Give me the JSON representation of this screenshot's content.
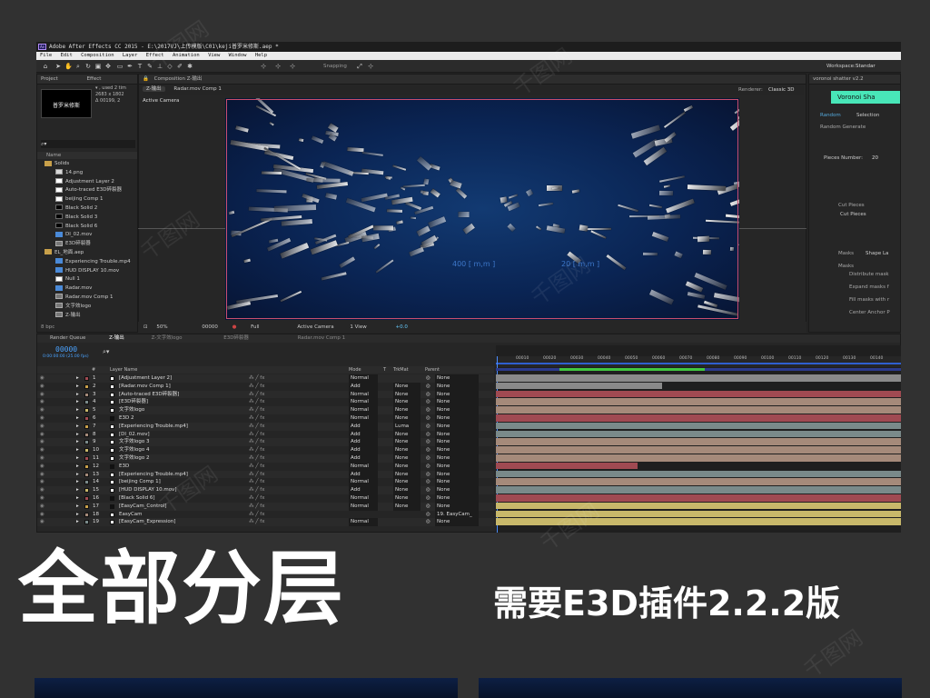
{
  "window": {
    "title": "Adobe After Effects CC 2015 - E:\\2017VJ\\上传模版\\C01\\keji普罗米修斯.aep *",
    "app_badge": "Ae"
  },
  "menu": [
    "File",
    "Edit",
    "Composition",
    "Layer",
    "Effect",
    "Animation",
    "View",
    "Window",
    "Help"
  ],
  "toolbar": {
    "snapping": "Snapping",
    "workspace_label": "Workspace:",
    "workspace_value": "Standar"
  },
  "project": {
    "tab": "Project",
    "tab2": "Effect",
    "thumb_caption": "普罗米修斯",
    "info": [
      "▾ , used 2 tim",
      "2683 x 1802",
      "Δ 00199, 2"
    ],
    "column_name": "Name",
    "items": [
      {
        "label": "Solids",
        "indent": 0,
        "type": "folder"
      },
      {
        "label": "14.png",
        "indent": 1,
        "type": "image"
      },
      {
        "label": "Adjustment Layer 2",
        "indent": 1,
        "type": "solid-white"
      },
      {
        "label": "Auto-traced E3D碎裂器",
        "indent": 1,
        "type": "solid-white"
      },
      {
        "label": "beijing Comp 1",
        "indent": 1,
        "type": "solid-white"
      },
      {
        "label": "Black Solid 2",
        "indent": 1,
        "type": "solid-black"
      },
      {
        "label": "Black Solid 3",
        "indent": 1,
        "type": "solid-black"
      },
      {
        "label": "Black Solid 6",
        "indent": 1,
        "type": "solid-black"
      },
      {
        "label": "DI_02.mov",
        "indent": 1,
        "type": "footage"
      },
      {
        "label": "E3D碎裂器",
        "indent": 1,
        "type": "comp"
      },
      {
        "label": "EL_地面.aep",
        "indent": 0,
        "type": "folder"
      },
      {
        "label": "Experiencing Trouble.mp4",
        "indent": 1,
        "type": "footage"
      },
      {
        "label": "HUD DISPLAY 10.mov",
        "indent": 1,
        "type": "footage"
      },
      {
        "label": "Null 1",
        "indent": 1,
        "type": "solid-white"
      },
      {
        "label": "Radar.mov",
        "indent": 1,
        "type": "footage"
      },
      {
        "label": "Radar.mov Comp 1",
        "indent": 1,
        "type": "comp"
      },
      {
        "label": "文字效logo",
        "indent": 1,
        "type": "comp"
      },
      {
        "label": "Z-输出",
        "indent": 1,
        "type": "comp"
      }
    ],
    "bpc": "8 bpc"
  },
  "composition": {
    "tab": "Composition Z-输出",
    "subtab1": "Z-输出",
    "subtab2": "Radar.mov Comp 1",
    "renderer_label": "Renderer:",
    "renderer_value": "Classic 3D",
    "camera_label": "Active Camera",
    "hud_text": "400 [ m,m ]",
    "hud_text2": "20 [ m,m ]",
    "zoom": "50%",
    "timecode": "00000",
    "resolution": "Full",
    "view_camera": "Active Camera",
    "views": "1 View",
    "exposure": "+0.0"
  },
  "effect_panel": {
    "title": "voronoi shatter v2.2",
    "button": "Voronoi Sha",
    "tabs": [
      "Random",
      "Selection"
    ],
    "section": "Random Generate",
    "pieces_label": "Pieces Number:",
    "pieces_value": "20",
    "cut_section": "Cut Pieces",
    "cut_label": "Cut Pieces",
    "tabs2": [
      "Masks",
      "Shape La"
    ],
    "masks_section": "Masks",
    "options": [
      "Distribute mask",
      "Expand masks f",
      "Fill masks with r",
      "Center Anchor P"
    ]
  },
  "timeline": {
    "tabs": [
      "Render Queue",
      "Z-输出",
      "Z-文字效logo",
      "E3D碎裂器",
      "Radar.mov Comp 1"
    ],
    "timecode": "00000",
    "timecode_sub": "0:00:00:00 (25.00 fps)",
    "columns": {
      "num": "#",
      "name": "Layer Name",
      "mode": "Mode",
      "t": "T",
      "trkmat": "TrkMat",
      "parent": "Parent"
    },
    "ruler": [
      "00010",
      "00020",
      "00030",
      "00040",
      "00050",
      "00060",
      "00070",
      "00080",
      "00090",
      "00100",
      "00110",
      "00120",
      "00130",
      "00140"
    ],
    "layers": [
      {
        "num": "1",
        "name": "[Adjustment Layer 2]",
        "color": "#ffffff",
        "mode": "Normal",
        "trkmat": "",
        "parent": "None",
        "bar": "#8a8a8a",
        "bar_end": 1.0
      },
      {
        "num": "2",
        "name": "[Radar.mov Comp 1]",
        "color": "#ffffff",
        "mode": "Add",
        "trkmat": "None",
        "parent": "None",
        "bar": "#8a8a8a",
        "bar_end": 0.41
      },
      {
        "num": "3",
        "name": "[Auto-traced E3D碎裂器]",
        "color": "#ffffff",
        "mode": "Normal",
        "trkmat": "None",
        "parent": "None",
        "bar": "#a04a52",
        "bar_end": 1.0
      },
      {
        "num": "4",
        "name": "[E3D碎裂器]",
        "color": "#ffffff",
        "mode": "Normal",
        "trkmat": "None",
        "parent": "None",
        "bar": "#a58a7a",
        "bar_end": 1.0
      },
      {
        "num": "5",
        "name": "文字效logo",
        "color": "#ffffff",
        "mode": "Normal",
        "trkmat": "None",
        "parent": "None",
        "bar": "#a58a7a",
        "bar_end": 1.0
      },
      {
        "num": "6",
        "name": "E3D 2",
        "color": "#111111",
        "mode": "Normal",
        "trkmat": "None",
        "parent": "None",
        "bar": "#a04a52",
        "bar_end": 1.0
      },
      {
        "num": "7",
        "name": "[Experiencing Trouble.mp4]",
        "color": "#ffffff",
        "mode": "Add",
        "trkmat": "Luma",
        "parent": "None",
        "bar": "#7a8a8a",
        "bar_end": 1.0
      },
      {
        "num": "8",
        "name": "[DI_02.mov]",
        "color": "#ffffff",
        "mode": "Add",
        "trkmat": "None",
        "parent": "None",
        "bar": "#7a8a8a",
        "bar_end": 1.0
      },
      {
        "num": "9",
        "name": "文字效logo 3",
        "color": "#ffffff",
        "mode": "Add",
        "trkmat": "None",
        "parent": "None",
        "bar": "#a58a7a",
        "bar_end": 1.0
      },
      {
        "num": "10",
        "name": "文字效logo 4",
        "color": "#ffffff",
        "mode": "Add",
        "trkmat": "None",
        "parent": "None",
        "bar": "#a58a7a",
        "bar_end": 1.0
      },
      {
        "num": "11",
        "name": "文字效logo 2",
        "color": "#ffffff",
        "mode": "Add",
        "trkmat": "None",
        "parent": "None",
        "bar": "#a58a7a",
        "bar_end": 1.0
      },
      {
        "num": "12",
        "name": "E3D",
        "color": "#111111",
        "mode": "Normal",
        "trkmat": "None",
        "parent": "None",
        "bar": "#a04a52",
        "bar_end": 0.35
      },
      {
        "num": "13",
        "name": "[Experiencing Trouble.mp4]",
        "color": "#ffffff",
        "mode": "Add",
        "trkmat": "None",
        "parent": "None",
        "bar": "#7a8a8a",
        "bar_end": 1.0
      },
      {
        "num": "14",
        "name": "[beijing Comp 1]",
        "color": "#ffffff",
        "mode": "Normal",
        "trkmat": "None",
        "parent": "None",
        "bar": "#a58a7a",
        "bar_end": 1.0
      },
      {
        "num": "15",
        "name": "[HUD DISPLAY 10.mov]",
        "color": "#ffffff",
        "mode": "Add",
        "trkmat": "None",
        "parent": "None",
        "bar": "#7a8a8a",
        "bar_end": 1.0
      },
      {
        "num": "16",
        "name": "[Black Solid 6]",
        "color": "#111111",
        "mode": "Normal",
        "trkmat": "None",
        "parent": "None",
        "bar": "#a04a52",
        "bar_end": 1.0
      },
      {
        "num": "17",
        "name": "[EasyCam_Control]",
        "color": "#111111",
        "mode": "Normal",
        "trkmat": "None",
        "parent": "None",
        "bar": "#c8b86a",
        "bar_end": 1.0
      },
      {
        "num": "18",
        "name": "EasyCam",
        "color": "#ffffff",
        "mode": "",
        "trkmat": "",
        "parent": "19. EasyCam_",
        "bar": "#c8b86a",
        "bar_end": 1.0
      },
      {
        "num": "19",
        "name": "[EasyCam_Expression]",
        "color": "#ffffff",
        "mode": "Normal",
        "trkmat": "",
        "parent": "None",
        "bar": "#c8b86a",
        "bar_end": 1.0
      }
    ]
  },
  "caption": {
    "headline": "全部分层",
    "subtext": "需要E3D插件2.2.2版"
  },
  "watermark": "千图网"
}
